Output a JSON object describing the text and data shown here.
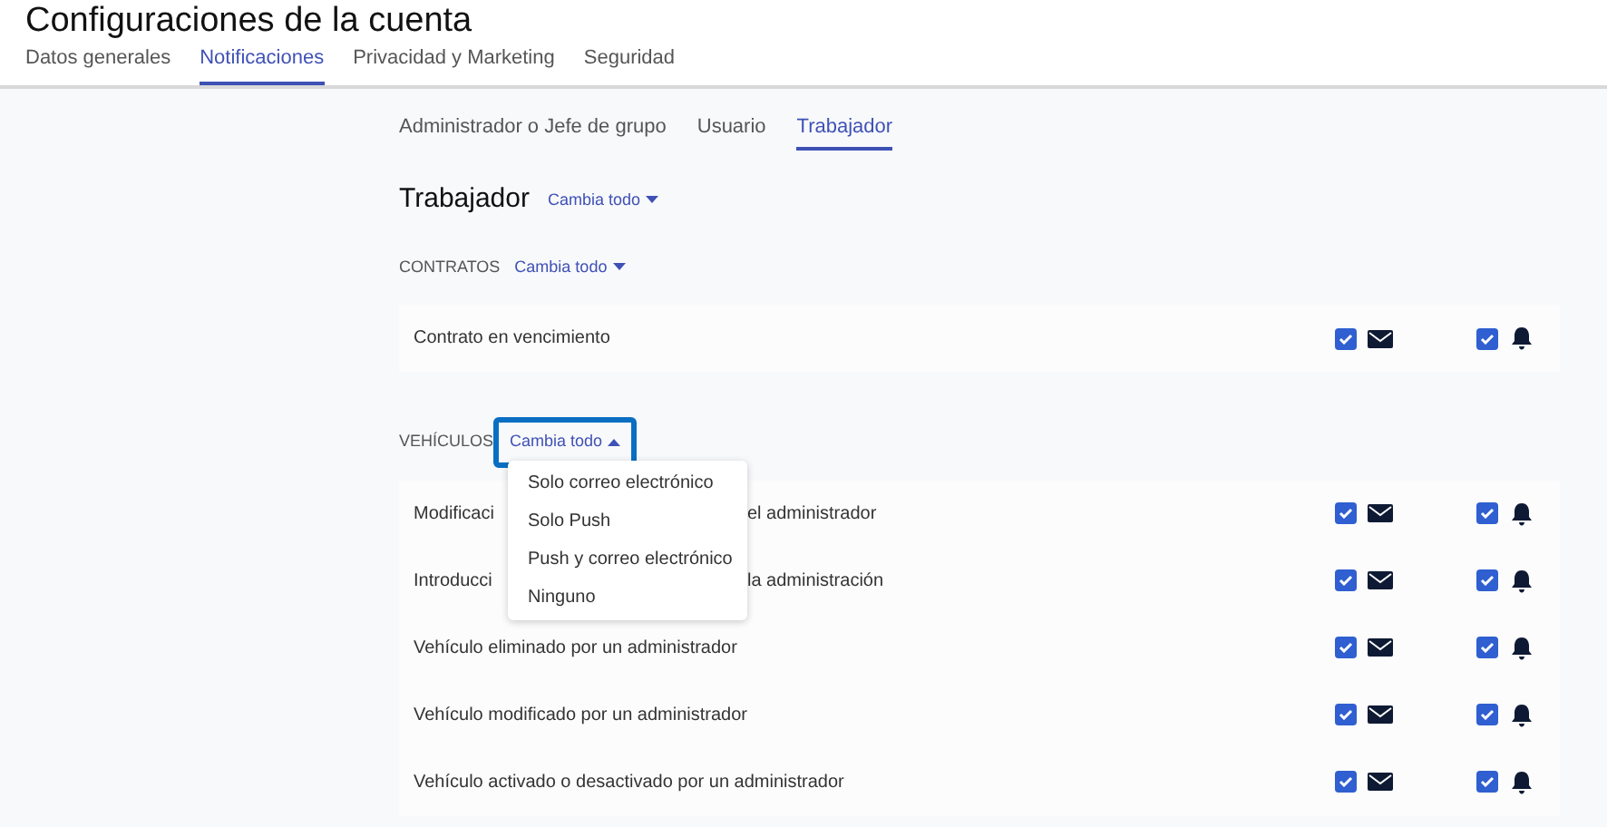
{
  "title": "Configuraciones de la cuenta",
  "tabs": [
    {
      "label": "Datos generales",
      "selected": false
    },
    {
      "label": "Notificaciones",
      "selected": true
    },
    {
      "label": "Privacidad y Marketing",
      "selected": false
    },
    {
      "label": "Seguridad",
      "selected": false
    }
  ],
  "role_tabs": [
    {
      "label": "Administrador o Jefe de grupo",
      "selected": false
    },
    {
      "label": "Usuario",
      "selected": false
    },
    {
      "label": "Trabajador",
      "selected": true
    }
  ],
  "heading": {
    "title": "Trabajador",
    "change_all": "Cambia todo",
    "expanded": false
  },
  "sections": [
    {
      "title": "CONTRATOS",
      "change_all": "Cambia todo",
      "expanded": false,
      "rows": [
        {
          "label": "Contrato en vencimiento",
          "email": true,
          "push": true
        }
      ]
    },
    {
      "title": "VEHÍCULOS",
      "change_all": "Cambia todo",
      "expanded": true,
      "menu": [
        "Solo correo electrónico",
        "Solo Push",
        "Push y correo electrónico",
        "Ninguno"
      ],
      "rows": [
        {
          "label": "Modificaci",
          "label_end": "el administrador",
          "email": true,
          "push": true
        },
        {
          "label": "Introducci",
          "label_end": "la administración",
          "email": true,
          "push": true
        },
        {
          "label": "Vehículo eliminado por un administrador",
          "email": true,
          "push": true
        },
        {
          "label": "Vehículo modificado por un administrador",
          "email": true,
          "push": true
        },
        {
          "label": "Vehículo activado o desactivado por un administrador",
          "email": true,
          "push": true
        }
      ]
    }
  ]
}
